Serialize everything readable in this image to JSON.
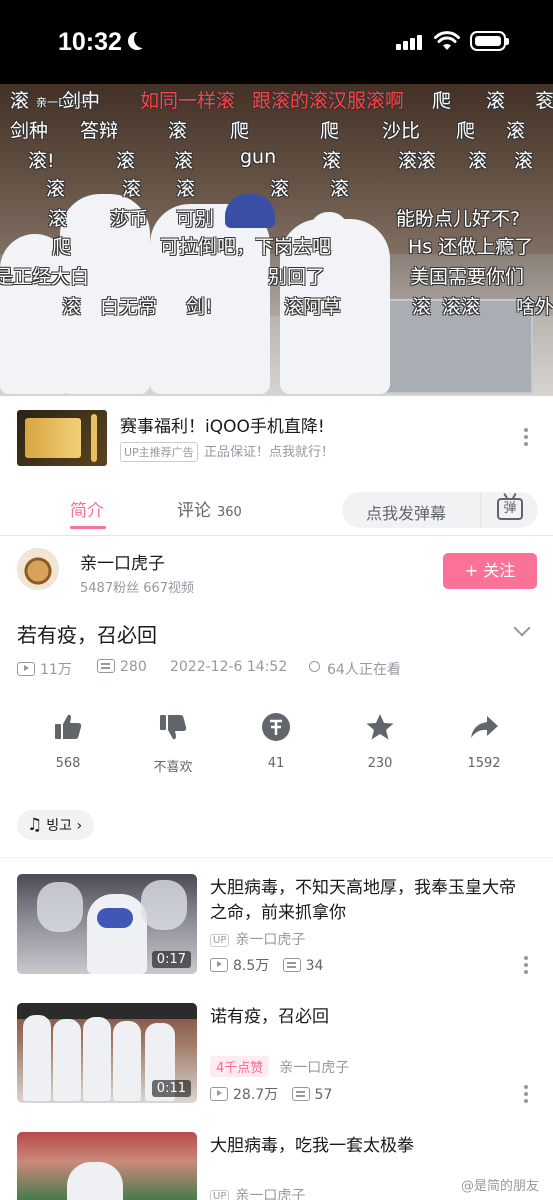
{
  "status_bar": {
    "time": "10:32"
  },
  "video": {
    "channel_overlay": "亲一口虎子",
    "danmaku": [
      {
        "text": "滚",
        "red": false
      },
      {
        "text": "剑中",
        "red": false
      },
      {
        "text": "如同一样滚",
        "red": true
      },
      {
        "text": "跟滚的滚汉服滚啊",
        "red": true
      },
      {
        "text": "爬",
        "red": false
      },
      {
        "text": "滚",
        "red": false
      },
      {
        "text": "衮",
        "red": false
      },
      {
        "text": "剑种",
        "red": false
      },
      {
        "text": "答辩",
        "red": false
      },
      {
        "text": "滚",
        "red": false
      },
      {
        "text": "爬",
        "red": false
      },
      {
        "text": "爬",
        "red": false
      },
      {
        "text": "沙比",
        "red": false
      },
      {
        "text": "爬",
        "red": false
      },
      {
        "text": "滚",
        "red": false
      },
      {
        "text": "滚!",
        "red": false
      },
      {
        "text": "滚",
        "red": false
      },
      {
        "text": "滚",
        "red": false
      },
      {
        "text": "gun",
        "red": false
      },
      {
        "text": "滚",
        "red": false
      },
      {
        "text": "滚滚",
        "red": false
      },
      {
        "text": "滚",
        "red": false
      },
      {
        "text": "滚",
        "red": false
      },
      {
        "text": "滚",
        "red": false
      },
      {
        "text": "滚",
        "red": false
      },
      {
        "text": "滚",
        "red": false
      },
      {
        "text": "滚",
        "red": false
      },
      {
        "text": "滚",
        "red": false
      },
      {
        "text": "滚",
        "red": false
      },
      {
        "text": "莎币",
        "red": false
      },
      {
        "text": "可别",
        "red": false
      },
      {
        "text": "能盼点儿好不?",
        "red": false
      },
      {
        "text": "爬",
        "red": false
      },
      {
        "text": "可拉倒吧，下岗去吧",
        "red": false
      },
      {
        "text": "Hs 还做上瘾了",
        "red": false
      },
      {
        "text": "是正经大白",
        "red": false
      },
      {
        "text": "别回了",
        "red": false
      },
      {
        "text": "美国需要你们",
        "red": false
      },
      {
        "text": "滚",
        "red": false
      },
      {
        "text": "白无常",
        "red": false
      },
      {
        "text": "剑!",
        "red": false
      },
      {
        "text": "滚阿草",
        "red": false
      },
      {
        "text": "滚",
        "red": false
      },
      {
        "text": "滚滚",
        "red": false
      },
      {
        "text": "啥外",
        "red": false
      }
    ]
  },
  "ad": {
    "title": "赛事福利！iQOO手机直降!",
    "tag": "UP主推荐广告",
    "subtitle": "正品保证！点我就行！"
  },
  "tabs": {
    "intro": "简介",
    "comments": "评论",
    "comments_count": "360",
    "danmu_placeholder": "点我发弹幕",
    "danmu_icon": "弹"
  },
  "uploader": {
    "name": "亲一口虎子",
    "meta": "5487粉丝  667视频",
    "follow": "+ 关注"
  },
  "video_info": {
    "title": "若有疫，召必回",
    "views": "11万",
    "danmu_count": "280",
    "datetime": "2022-12-6 14:52",
    "watching": "64人正在看"
  },
  "actions": {
    "like": "568",
    "dislike": "不喜欢",
    "coin": "41",
    "favorite": "230",
    "share": "1592"
  },
  "music": {
    "label": "빙고"
  },
  "related": [
    {
      "title": "大胆病毒，不知天高地厚，我奉玉皇大帝之命，前来抓拿你",
      "up_tag": "UP",
      "up_name": "亲一口虎子",
      "views": "8.5万",
      "danmu": "34",
      "duration": "0:17",
      "hot": ""
    },
    {
      "title": "诺有疫，召必回",
      "up_tag": "",
      "up_name": "亲一口虎子",
      "views": "28.7万",
      "danmu": "57",
      "duration": "0:11",
      "hot": "4千点赞"
    },
    {
      "title": "大胆病毒，吃我一套太极拳",
      "up_tag": "UP",
      "up_name": "亲一口虎子",
      "views": "",
      "danmu": "",
      "duration": "",
      "hot": ""
    }
  ],
  "watermark": "@是简的朋友",
  "colors": {
    "accent": "#fb7299",
    "text": "#18191c",
    "muted": "#9499a0"
  }
}
